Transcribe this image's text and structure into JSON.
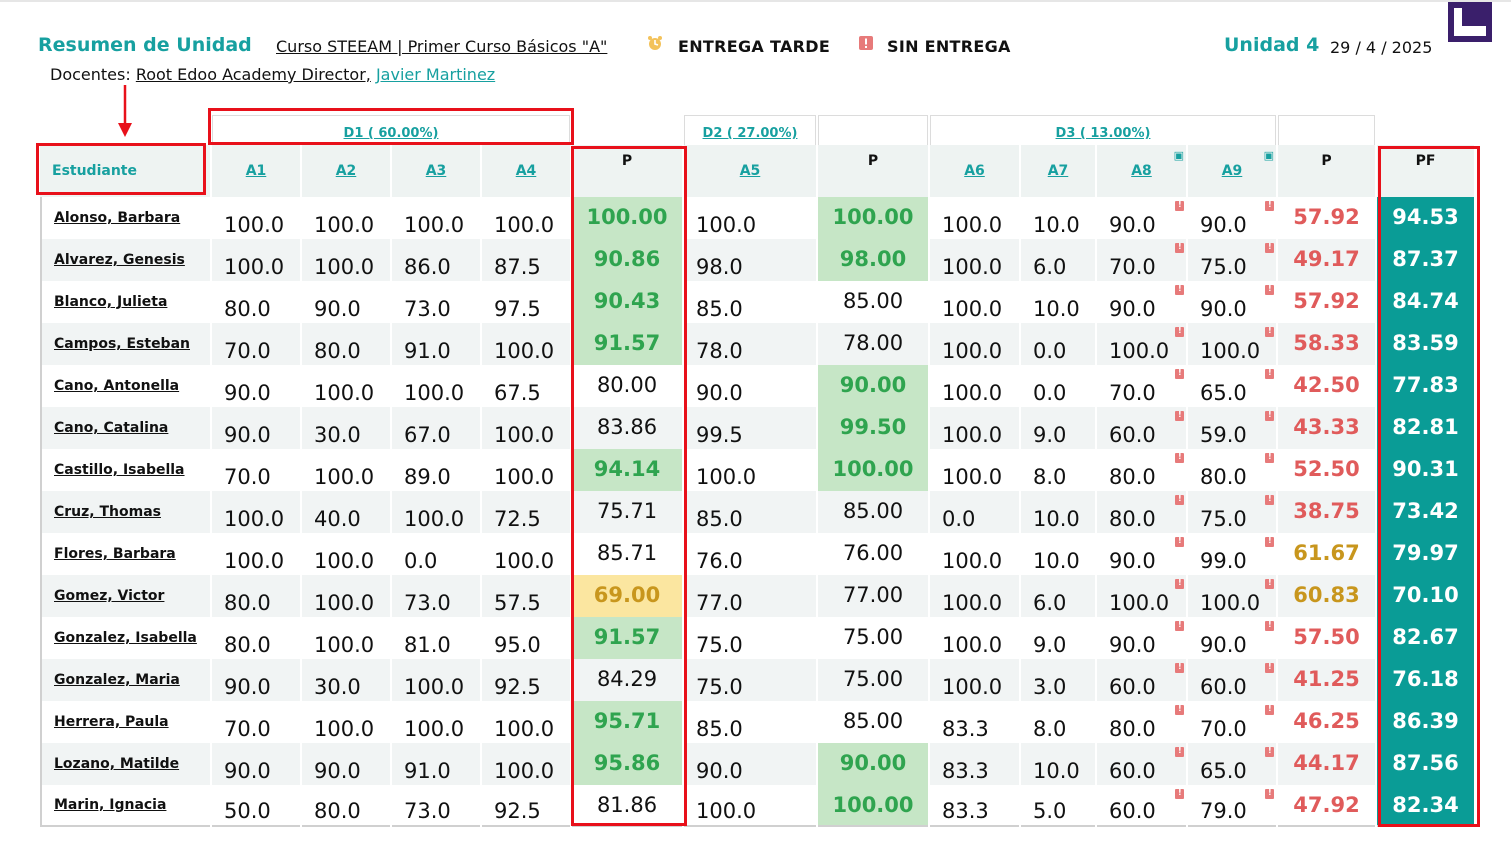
{
  "header": {
    "title": "Resumen de Unidad",
    "course": "Curso STEEAM | Primer Curso Básicos \"A\"",
    "legend_late": "ENTREGA TARDE",
    "legend_missing": "SIN ENTREGA",
    "unit": "Unidad 4",
    "date": "29 / 4 / 2025",
    "teachers_label": "Docentes:",
    "teacher_1": "Root Edoo Academy Director,",
    "teacher_2": "Javier Martinez"
  },
  "colors": {
    "accent": "#17a0a0",
    "pf_bg": "#0a9c96",
    "good": "#2fa44f",
    "warn": "#c8961d",
    "bad": "#e05b5b",
    "highlight": "#e8101a"
  },
  "table": {
    "groups": {
      "d1": "D1 ( 60.00%)",
      "d2": "D2 ( 27.00%)",
      "d3": "D3 ( 13.00%)"
    },
    "headers": {
      "student": "Estudiante",
      "a1": "A1",
      "a2": "A2",
      "a3": "A3",
      "a4": "A4",
      "p1": "P",
      "a5": "A5",
      "p2": "P",
      "a6": "A6",
      "a7": "A7",
      "a8": "A8",
      "a9": "A9",
      "p3": "P",
      "pf": "PF"
    },
    "rows": [
      {
        "name": "Alonso, Barbara",
        "a1": "100.0",
        "a2": "100.0",
        "a3": "100.0",
        "a4": "100.0",
        "p1": "100.00",
        "p1s": "green",
        "a5": "100.0",
        "p2": "100.00",
        "p2s": "green",
        "a6": "100.0",
        "a7": "10.0",
        "a8": "90.0",
        "a9": "90.0",
        "p3": "57.92",
        "p3s": "red-text",
        "pf": "94.53"
      },
      {
        "name": "Alvarez, Genesis",
        "a1": "100.0",
        "a2": "100.0",
        "a3": "86.0",
        "a4": "87.5",
        "p1": "90.86",
        "p1s": "green",
        "a5": "98.0",
        "p2": "98.00",
        "p2s": "green",
        "a6": "100.0",
        "a7": "6.0",
        "a8": "70.0",
        "a9": "75.0",
        "p3": "49.17",
        "p3s": "red-text",
        "pf": "87.37"
      },
      {
        "name": "Blanco, Julieta",
        "a1": "80.0",
        "a2": "90.0",
        "a3": "73.0",
        "a4": "97.5",
        "p1": "90.43",
        "p1s": "green",
        "a5": "85.0",
        "p2": "85.00",
        "p2s": "plain",
        "a6": "100.0",
        "a7": "10.0",
        "a8": "90.0",
        "a9": "90.0",
        "p3": "57.92",
        "p3s": "red-text",
        "pf": "84.74"
      },
      {
        "name": "Campos, Esteban",
        "a1": "70.0",
        "a2": "80.0",
        "a3": "91.0",
        "a4": "100.0",
        "p1": "91.57",
        "p1s": "green",
        "a5": "78.0",
        "p2": "78.00",
        "p2s": "plain",
        "a6": "100.0",
        "a7": "0.0",
        "a8": "100.0",
        "a9": "100.0",
        "p3": "58.33",
        "p3s": "red-text",
        "pf": "83.59"
      },
      {
        "name": "Cano, Antonella",
        "a1": "90.0",
        "a2": "100.0",
        "a3": "100.0",
        "a4": "67.5",
        "p1": "80.00",
        "p1s": "plain",
        "a5": "90.0",
        "p2": "90.00",
        "p2s": "green",
        "a6": "100.0",
        "a7": "0.0",
        "a8": "70.0",
        "a9": "65.0",
        "p3": "42.50",
        "p3s": "red-text",
        "pf": "77.83"
      },
      {
        "name": "Cano, Catalina",
        "a1": "90.0",
        "a2": "30.0",
        "a3": "67.0",
        "a4": "100.0",
        "p1": "83.86",
        "p1s": "plain",
        "a5": "99.5",
        "p2": "99.50",
        "p2s": "green",
        "a6": "100.0",
        "a7": "9.0",
        "a8": "60.0",
        "a9": "59.0",
        "p3": "43.33",
        "p3s": "red-text",
        "pf": "82.81"
      },
      {
        "name": "Castillo, Isabella",
        "a1": "70.0",
        "a2": "100.0",
        "a3": "89.0",
        "a4": "100.0",
        "p1": "94.14",
        "p1s": "green",
        "a5": "100.0",
        "p2": "100.00",
        "p2s": "green",
        "a6": "100.0",
        "a7": "8.0",
        "a8": "80.0",
        "a9": "80.0",
        "p3": "52.50",
        "p3s": "red-text",
        "pf": "90.31"
      },
      {
        "name": "Cruz, Thomas",
        "a1": "100.0",
        "a2": "40.0",
        "a3": "100.0",
        "a4": "72.5",
        "p1": "75.71",
        "p1s": "plain",
        "a5": "85.0",
        "p2": "85.00",
        "p2s": "plain",
        "a6": "0.0",
        "a7": "10.0",
        "a8": "80.0",
        "a9": "75.0",
        "p3": "38.75",
        "p3s": "red-text",
        "pf": "73.42"
      },
      {
        "name": "Flores, Barbara",
        "a1": "100.0",
        "a2": "100.0",
        "a3": "0.0",
        "a4": "100.0",
        "p1": "85.71",
        "p1s": "plain",
        "a5": "76.0",
        "p2": "76.00",
        "p2s": "plain",
        "a6": "100.0",
        "a7": "10.0",
        "a8": "90.0",
        "a9": "99.0",
        "p3": "61.67",
        "p3s": "yellow-text",
        "pf": "79.97"
      },
      {
        "name": "Gomez, Victor",
        "a1": "80.0",
        "a2": "100.0",
        "a3": "73.0",
        "a4": "57.5",
        "p1": "69.00",
        "p1s": "yellow",
        "a5": "77.0",
        "p2": "77.00",
        "p2s": "plain",
        "a6": "100.0",
        "a7": "6.0",
        "a8": "100.0",
        "a9": "100.0",
        "p3": "60.83",
        "p3s": "yellow-text",
        "pf": "70.10"
      },
      {
        "name": "Gonzalez, Isabella",
        "a1": "80.0",
        "a2": "100.0",
        "a3": "81.0",
        "a4": "95.0",
        "p1": "91.57",
        "p1s": "green",
        "a5": "75.0",
        "p2": "75.00",
        "p2s": "plain",
        "a6": "100.0",
        "a7": "9.0",
        "a8": "90.0",
        "a9": "90.0",
        "p3": "57.50",
        "p3s": "red-text",
        "pf": "82.67"
      },
      {
        "name": "Gonzalez, Maria",
        "a1": "90.0",
        "a2": "30.0",
        "a3": "100.0",
        "a4": "92.5",
        "p1": "84.29",
        "p1s": "plain",
        "a5": "75.0",
        "p2": "75.00",
        "p2s": "plain",
        "a6": "100.0",
        "a7": "3.0",
        "a8": "60.0",
        "a9": "60.0",
        "p3": "41.25",
        "p3s": "red-text",
        "pf": "76.18"
      },
      {
        "name": "Herrera, Paula",
        "a1": "70.0",
        "a2": "100.0",
        "a3": "100.0",
        "a4": "100.0",
        "p1": "95.71",
        "p1s": "green",
        "a5": "85.0",
        "p2": "85.00",
        "p2s": "plain",
        "a6": "83.3",
        "a7": "8.0",
        "a8": "80.0",
        "a9": "70.0",
        "p3": "46.25",
        "p3s": "red-text",
        "pf": "86.39"
      },
      {
        "name": "Lozano, Matilde",
        "a1": "90.0",
        "a2": "90.0",
        "a3": "91.0",
        "a4": "100.0",
        "p1": "95.86",
        "p1s": "green",
        "a5": "90.0",
        "p2": "90.00",
        "p2s": "green",
        "a6": "83.3",
        "a7": "10.0",
        "a8": "60.0",
        "a9": "65.0",
        "p3": "44.17",
        "p3s": "red-text",
        "pf": "87.56"
      },
      {
        "name": "Marin, Ignacia",
        "a1": "50.0",
        "a2": "80.0",
        "a3": "73.0",
        "a4": "92.5",
        "p1": "81.86",
        "p1s": "plain",
        "a5": "100.0",
        "p2": "100.00",
        "p2s": "green",
        "a6": "83.3",
        "a7": "5.0",
        "a8": "60.0",
        "a9": "79.0",
        "p3": "47.92",
        "p3s": "red-text",
        "pf": "82.34"
      }
    ]
  }
}
